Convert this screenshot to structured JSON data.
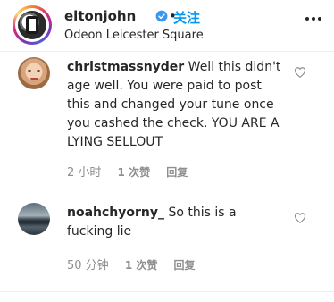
{
  "header": {
    "username": "eltonjohn",
    "follow_label": "关注",
    "separator": "•",
    "location": "Odeon Leicester Square",
    "verified_icon": "verified-badge-icon",
    "more_icon": "more-options-icon"
  },
  "comments": [
    {
      "user": "christmassnyder",
      "text": " Well this didn't age well. You were paid to post this and changed your tune once you cashed the check. YOU ARE A LYING SELLOUT",
      "time": "2 小时",
      "likes": "1 次赞",
      "reply": "回复",
      "avatar_icon": "user-avatar"
    },
    {
      "user": "noahchyorny_",
      "text": " So this is a fucking lie",
      "time": "50 分钟",
      "likes": "1 次赞",
      "reply": "回复",
      "avatar_icon": "user-avatar"
    }
  ],
  "colors": {
    "link_blue": "#0095f6",
    "meta_gray": "#8e8e8e",
    "text": "#262626"
  }
}
